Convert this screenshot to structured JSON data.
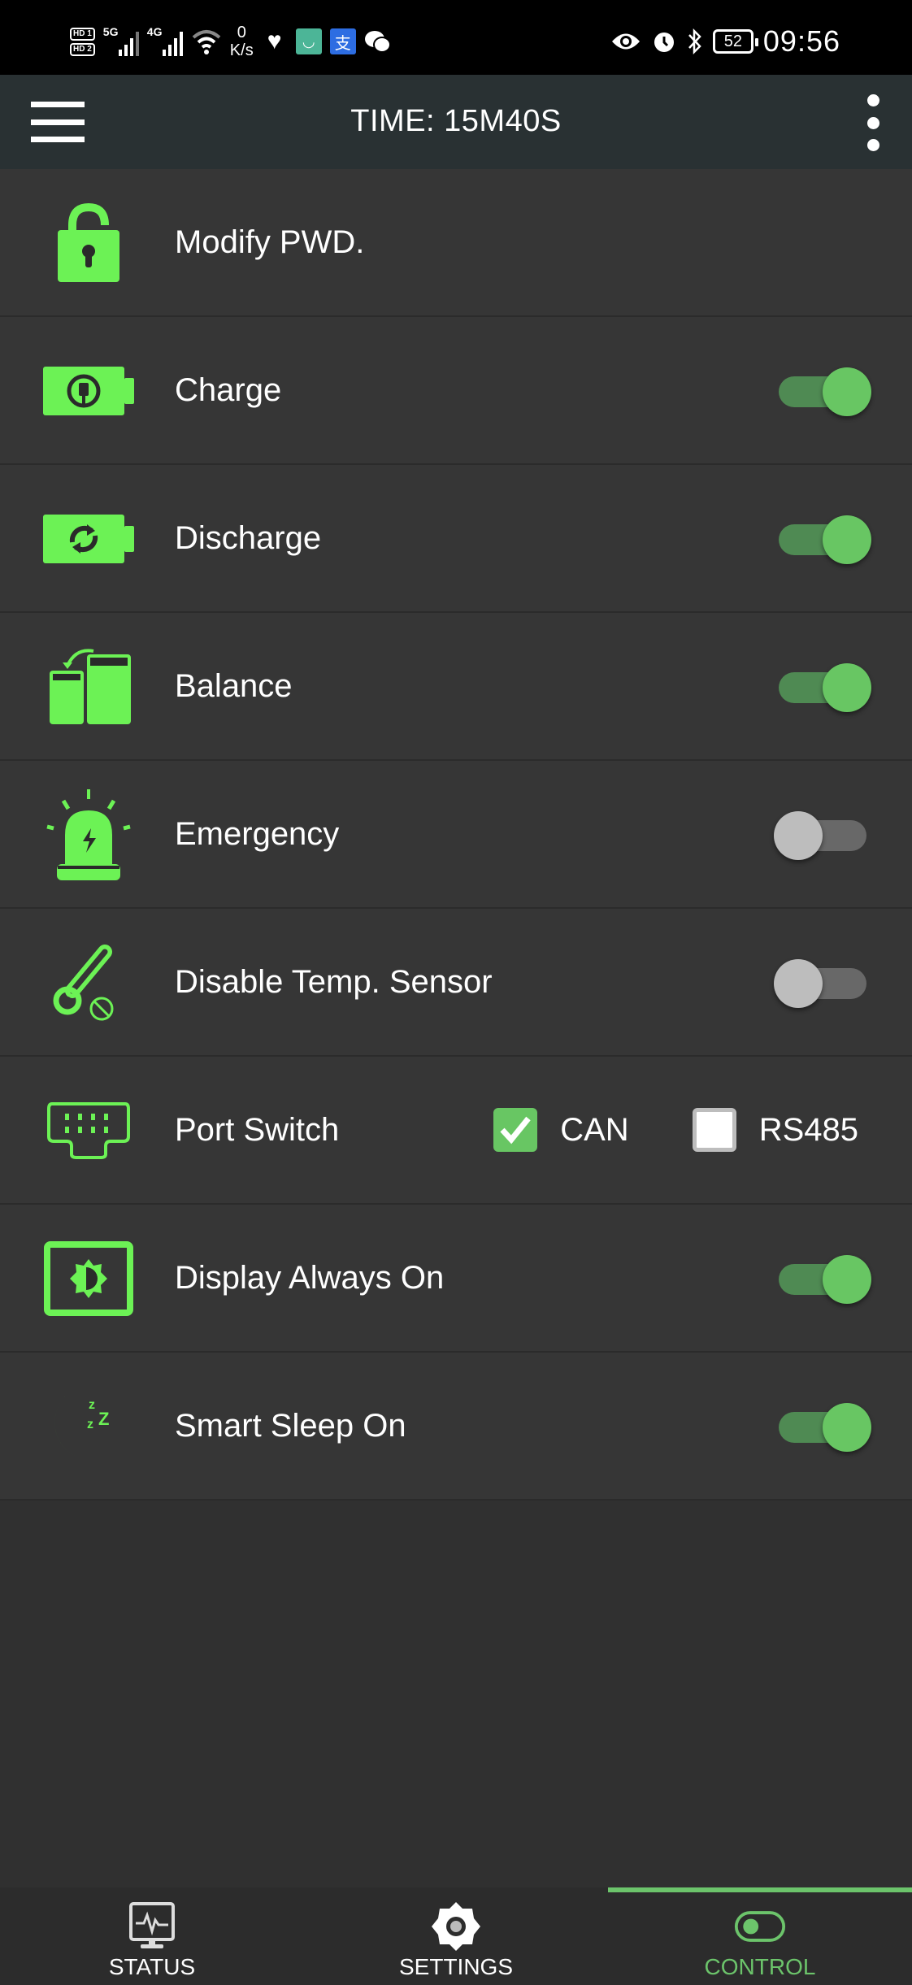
{
  "status_bar": {
    "sim1": "HD 1",
    "sim2": "HD 2",
    "net1": "5G",
    "net2": "4G",
    "speed_value": "0",
    "speed_unit": "K/s",
    "battery": "52",
    "time": "09:56",
    "icons": [
      "hd-sim-icon",
      "signal-5g-icon",
      "signal-4g-icon",
      "wifi-icon",
      "health-heart-icon",
      "mi-home-icon",
      "alipay-icon",
      "wechat-icon",
      "eye-comfort-icon",
      "alarm-icon",
      "bluetooth-icon",
      "battery-icon"
    ]
  },
  "app_bar": {
    "title": "TIME: 15M40S",
    "menu_icon": "hamburger-menu-icon",
    "overflow_icon": "more-vert-icon"
  },
  "colors": {
    "accent": "#6cc46b",
    "icon_green": "#6cf255",
    "row_bg": "#363636",
    "app_bar_bg": "#293133",
    "switch_on_thumb": "#68c663",
    "switch_on_track": "#4f8a53",
    "switch_off_thumb": "#bdbdbd",
    "switch_off_track": "#686868"
  },
  "controls": [
    {
      "id": "modify-pwd",
      "label": "Modify PWD.",
      "icon": "lock-icon",
      "type": "action"
    },
    {
      "id": "charge",
      "label": "Charge",
      "icon": "battery-charge-icon",
      "type": "switch",
      "on": true
    },
    {
      "id": "discharge",
      "label": "Discharge",
      "icon": "battery-discharge-icon",
      "type": "switch",
      "on": true
    },
    {
      "id": "balance",
      "label": "Balance",
      "icon": "battery-balance-icon",
      "type": "switch",
      "on": true
    },
    {
      "id": "emergency",
      "label": "Emergency",
      "icon": "emergency-siren-icon",
      "type": "switch",
      "on": false
    },
    {
      "id": "disable-temp-sensor",
      "label": "Disable Temp. Sensor",
      "icon": "thermometer-disabled-icon",
      "type": "switch",
      "on": false
    },
    {
      "id": "port-switch",
      "label": "Port Switch",
      "icon": "port-connector-icon",
      "type": "checkboxes",
      "options": [
        {
          "label": "CAN",
          "checked": true
        },
        {
          "label": "RS485",
          "checked": false
        }
      ]
    },
    {
      "id": "display-always-on",
      "label": "Display Always On",
      "icon": "display-brightness-icon",
      "type": "switch",
      "on": true
    },
    {
      "id": "smart-sleep-on",
      "label": "Smart Sleep On",
      "icon": "moon-sleep-icon",
      "type": "switch",
      "on": true
    }
  ],
  "bottom_nav": {
    "tabs": [
      {
        "label": "STATUS",
        "icon": "monitor-pulse-icon",
        "active": false
      },
      {
        "label": "SETTINGS",
        "icon": "gear-icon",
        "active": false
      },
      {
        "label": "CONTROL",
        "icon": "toggle-icon",
        "active": true
      }
    ]
  }
}
